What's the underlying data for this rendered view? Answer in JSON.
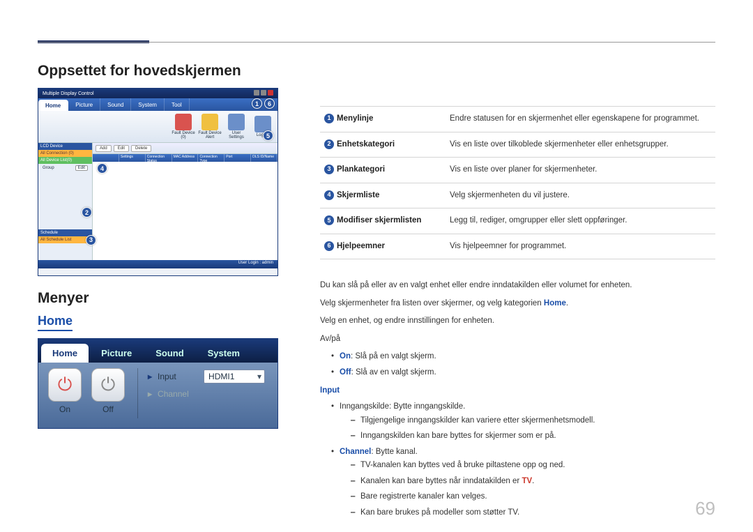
{
  "page_number": "69",
  "headings": {
    "main": "Oppsettet for hovedskjermen",
    "menus": "Menyer",
    "home": "Home"
  },
  "app_window": {
    "title": "Multiple Display Control",
    "tabs": [
      "Home",
      "Picture",
      "Sound",
      "System",
      "Tool"
    ],
    "toolbar": {
      "fault_device": "Fault Device (0)",
      "fault_alert": "Fault Device Alert",
      "user_settings": "User Settings",
      "logout": "Logout"
    },
    "sidebar": {
      "lcd_header": "LCD Device",
      "all_conn": "All Connection (0)",
      "all_list": "All Device List(0)",
      "group": "Group",
      "edit": "Edit",
      "schedule_header": "Schedule",
      "all_schedule": "All Schedule List"
    },
    "main_bar": {
      "add": "Add",
      "edit": "Edit",
      "delete": "Delete"
    },
    "grid_cols": [
      "",
      "Settings",
      "Connection Status",
      "MAC Address",
      "Connection Type",
      "Port",
      "DLS ID/Name"
    ],
    "status": "User Login : admin"
  },
  "home_shot": {
    "tabs": [
      "Home",
      "Picture",
      "Sound",
      "System"
    ],
    "on": "On",
    "off": "Off",
    "input_label": "Input",
    "input_value": "HDMI1",
    "channel_label": "Channel"
  },
  "legend": [
    {
      "num": "1",
      "label": "Menylinje",
      "desc": "Endre statusen for en skjermenhet eller egenskapene for programmet."
    },
    {
      "num": "2",
      "label": "Enhetskategori",
      "desc": "Vis en liste over tilkoblede skjermenheter eller enhetsgrupper."
    },
    {
      "num": "3",
      "label": "Plankategori",
      "desc": "Vis en liste over planer for skjermenheter."
    },
    {
      "num": "4",
      "label": "Skjermliste",
      "desc": "Velg skjermenheten du vil justere."
    },
    {
      "num": "5",
      "label": "Modifiser skjermlisten",
      "desc": "Legg til, rediger, omgrupper eller slett oppføringer."
    },
    {
      "num": "6",
      "label": "Hjelpeemner",
      "desc": "Vis hjelpeemner for programmet."
    }
  ],
  "body": {
    "p1": "Du kan slå på eller av en valgt enhet eller endre inndatakilden eller volumet for enheten.",
    "p2a": "Velg skjermenheter fra listen over skjermer, og velg kategorien ",
    "p2b": "Home",
    "p2c": ".",
    "p3": "Velg en enhet, og endre innstillingen for enheten.",
    "onoff_h": "Av/på",
    "on_bold": "On",
    "on_rest": ": Slå på en valgt skjerm.",
    "off_bold": "Off",
    "off_rest": ": Slå av en valgt skjerm.",
    "input_h": "Input",
    "input_item": "Inngangskilde: Bytte inngangskilde.",
    "input_d1": "Tilgjengelige inngangskilder kan variere etter skjermenhetsmodell.",
    "input_d2": "Inngangskilden kan bare byttes for skjermer som er på.",
    "channel_bold": "Channel",
    "channel_rest": ": Bytte kanal.",
    "ch_d1": "TV-kanalen kan byttes ved å bruke piltastene opp og ned.",
    "ch_d2a": "Kanalen kan bare byttes når inndatakilden er ",
    "ch_d2b": "TV",
    "ch_d2c": ".",
    "ch_d3": "Bare registrerte kanaler kan velges.",
    "ch_d4": "Kan bare brukes på modeller som støtter TV."
  }
}
